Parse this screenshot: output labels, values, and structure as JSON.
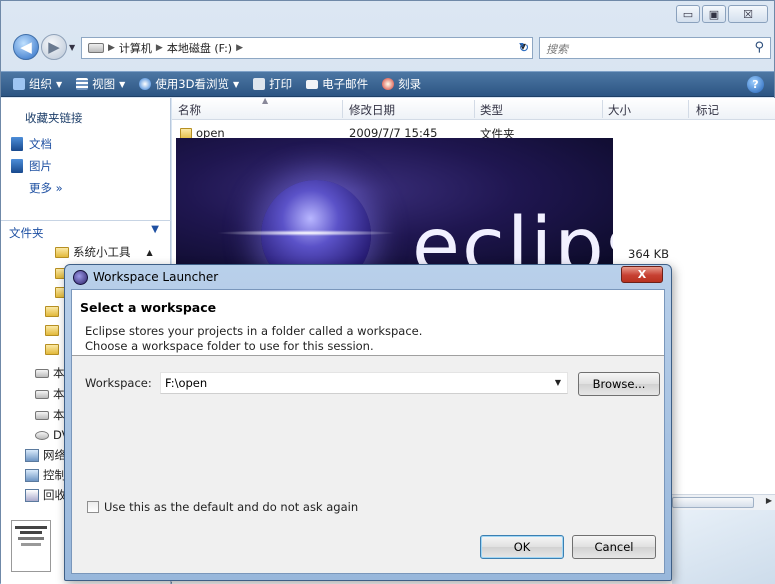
{
  "explorer": {
    "address": {
      "crumbs": [
        "计算机",
        "本地磁盘 (F:)"
      ]
    },
    "search_placeholder": "搜索",
    "toolbar": {
      "organize": "组织",
      "views": "视图",
      "browse3d": "使用3D看浏览",
      "print": "打印",
      "email": "电子邮件",
      "burn": "刻录"
    },
    "left": {
      "favorites_header": "收藏夹链接",
      "favorites": [
        "文档",
        "图片"
      ],
      "more": "更多",
      "folders_header": "文件夹",
      "tree_first": "系统小工具",
      "tree_partial": [
        "本",
        "本",
        "本",
        "DV",
        "网络",
        "控制",
        "回收"
      ]
    },
    "columns": [
      "名称",
      "修改日期",
      "类型",
      "大小",
      "标记"
    ],
    "files": [
      {
        "name": "open",
        "date": "2009/7/7 15:45",
        "type": "文件夹",
        "size": ""
      },
      {
        "name": "",
        "date": "",
        "type": "",
        "size": "364 KB"
      }
    ]
  },
  "splash": {
    "logo": "eclipse"
  },
  "dialog": {
    "title": "Workspace Launcher",
    "close_label": "X",
    "heading": "Select a workspace",
    "message_line1": "Eclipse stores your projects in a folder called a workspace.",
    "message_line2": "Choose a workspace folder to use for this session.",
    "workspace_label": "Workspace:",
    "workspace_value": "F:\\open",
    "browse_label": "Browse...",
    "default_checkbox_label": "Use this as the default and do not ask again",
    "default_checked": false,
    "ok_label": "OK",
    "cancel_label": "Cancel"
  }
}
